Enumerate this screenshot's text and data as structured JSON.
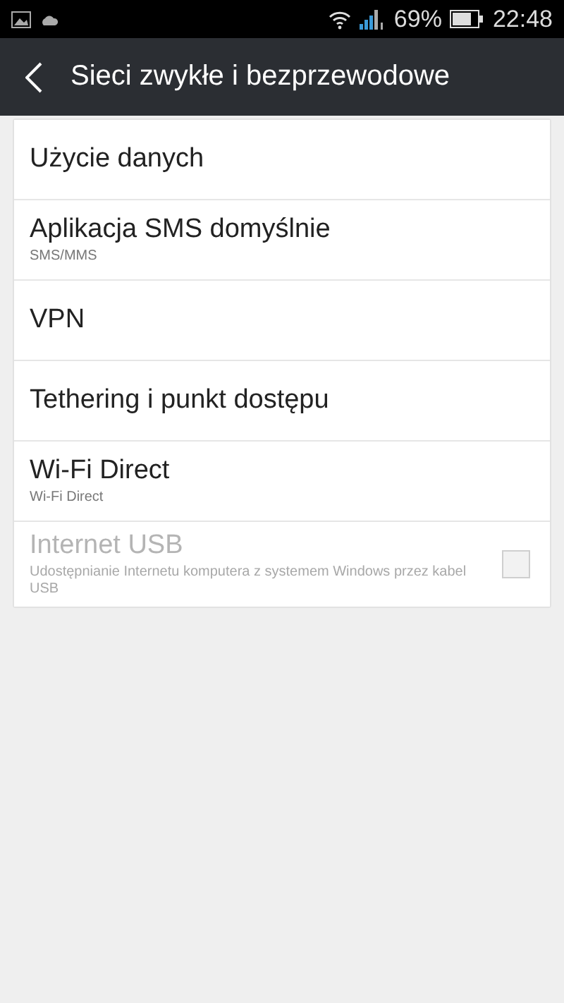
{
  "status_bar": {
    "battery": "69%",
    "time": "22:48"
  },
  "header": {
    "title": "Sieci zwykłe i bezprzewodowe"
  },
  "items": [
    {
      "kind": "plain",
      "title": "Użycie danych",
      "disabled": false
    },
    {
      "kind": "plain",
      "title": "Aplikacja SMS domyślnie",
      "subtitle": "SMS/MMS",
      "disabled": false
    },
    {
      "kind": "plain",
      "title": "VPN",
      "disabled": false
    },
    {
      "kind": "plain",
      "title": "Tethering i punkt dostępu",
      "disabled": false
    },
    {
      "kind": "plain",
      "title": "Wi-Fi Direct",
      "subtitle": "Wi-Fi Direct",
      "disabled": false
    },
    {
      "kind": "checkbox",
      "title": "Internet USB",
      "subtitle": "Udostępnianie Internetu komputera z systemem Windows przez kabel USB",
      "disabled": true,
      "checked": false
    }
  ]
}
